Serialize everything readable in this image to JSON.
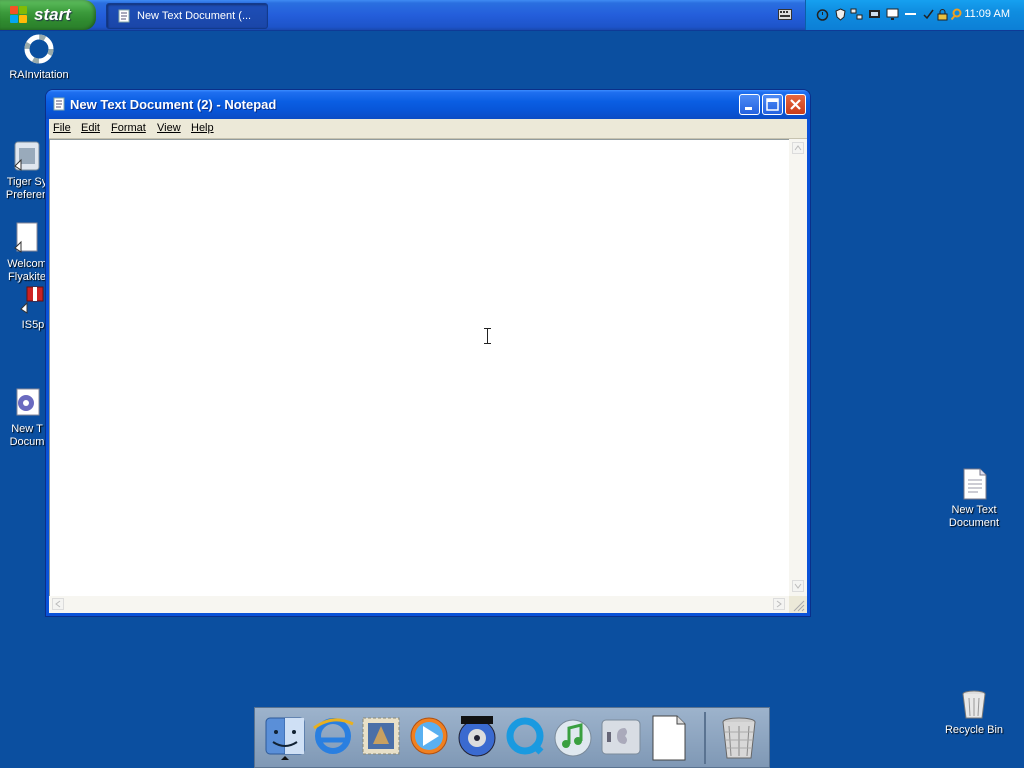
{
  "taskbar": {
    "start_label": "start",
    "task_button_label": "New Text Document (...",
    "clock": "11:09 AM"
  },
  "desktop_icons": [
    {
      "label": "RAInvitation"
    },
    {
      "label": "Tiger Sy\nPreferen"
    },
    {
      "label": "Welcom\nFlyakite"
    },
    {
      "label": "IS5p"
    },
    {
      "label": "New T\nDocum"
    },
    {
      "label": "New Text\nDocument"
    },
    {
      "label": "Recycle Bin"
    }
  ],
  "notepad": {
    "title": "New Text Document (2) - Notepad",
    "menu": [
      "File",
      "Edit",
      "Format",
      "View",
      "Help"
    ],
    "content": ""
  },
  "dock": {
    "items": [
      "finder-icon",
      "internet-explorer-icon",
      "mail-stamp-icon",
      "media-player-icon",
      "dvd-player-icon",
      "quicktime-icon",
      "itunes-icon",
      "system-preferences-icon",
      "blank-document-icon",
      "trash-icon"
    ]
  },
  "colors": {
    "desktop": "#0b4fa0",
    "taskbar": "#245edb",
    "start_green": "#3c9b3c",
    "title_blue": "#0855d8",
    "close_red": "#c93c1a"
  }
}
